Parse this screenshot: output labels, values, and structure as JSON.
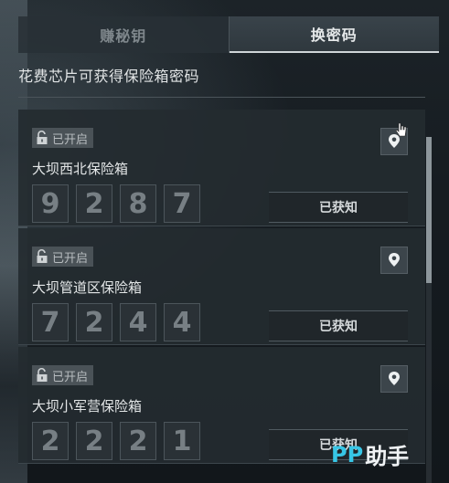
{
  "tabs": [
    {
      "label": "赚秘钥",
      "active": false
    },
    {
      "label": "换密码",
      "active": true
    }
  ],
  "subtitle": "花费芯片可获得保险箱密码",
  "safes": [
    {
      "status": "已开启",
      "name": "大坝西北保险箱",
      "code": [
        "9",
        "2",
        "8",
        "7"
      ],
      "button": "已获知"
    },
    {
      "status": "已开启",
      "name": "大坝管道区保险箱",
      "code": [
        "7",
        "2",
        "4",
        "4"
      ],
      "button": "已获知"
    },
    {
      "status": "已开启",
      "name": "大坝小军营保险箱",
      "code": [
        "2",
        "2",
        "2",
        "1"
      ],
      "button": "已获知"
    }
  ],
  "watermark": {
    "brand": "PP",
    "suffix": "助手"
  },
  "colors": {
    "accent": "#37c6e6",
    "panel": "#242b30",
    "text": "#e4e7e8"
  },
  "icons": {
    "status": "unlock-icon",
    "location": "map-pin-icon"
  }
}
